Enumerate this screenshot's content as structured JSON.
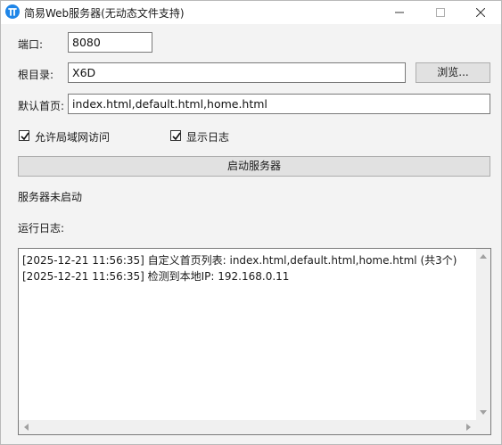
{
  "window": {
    "title": "简易Web服务器(无动态文件支持)",
    "icon": "app-logo-icon"
  },
  "form": {
    "port_label": "端口:",
    "port_value": "8080",
    "root_label": "根目录:",
    "root_value": "X6D",
    "browse_label": "浏览...",
    "default_label": "默认首页:",
    "default_value": "index.html,default.html,home.html",
    "allow_lan_label": "允许局域网访问",
    "allow_lan_checked": true,
    "show_log_label": "显示日志",
    "show_log_checked": true,
    "start_button_label": "启动服务器"
  },
  "status": {
    "text": "服务器未启动"
  },
  "log": {
    "label": "运行日志:",
    "lines": [
      "[2025-12-21 11:56:35] 自定义首页列表: index.html,default.html,home.html (共3个)",
      "[2025-12-21 11:56:35] 检测到本地IP: 192.168.0.11"
    ]
  }
}
